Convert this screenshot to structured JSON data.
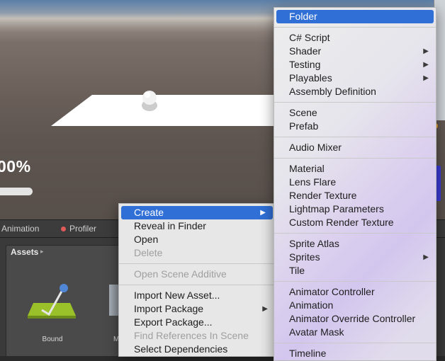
{
  "scene": {
    "progress_text": "00%",
    "progress_fraction": 0.88,
    "colors": {
      "plane": "#ffffff",
      "ball": "#e8e8e8",
      "bar": "#e4e4e4",
      "accent_blue": "#3d3bd9"
    }
  },
  "tabs": {
    "animation": "Animation",
    "profiler": "Profiler",
    "profiler_icon": "profiler-dot-icon"
  },
  "project": {
    "assets_title": "Assets",
    "asset_items": [
      {
        "label": "Bound",
        "icon": "mesh-asset-icon"
      },
      {
        "label": "M",
        "icon": "cube-asset-icon"
      }
    ]
  },
  "context_menu": {
    "items": [
      {
        "label": "Create",
        "submenu": true,
        "selected": true
      },
      {
        "label": "Reveal in Finder"
      },
      {
        "label": "Open"
      },
      {
        "label": "Delete",
        "disabled": true
      },
      {
        "label": "Open Scene Additive",
        "disabled": true
      },
      {
        "label": "Import New Asset..."
      },
      {
        "label": "Import Package",
        "submenu": true
      },
      {
        "label": "Export Package..."
      },
      {
        "label": "Find References In Scene",
        "disabled": true
      },
      {
        "label": "Select Dependencies"
      }
    ]
  },
  "create_submenu": {
    "items": [
      {
        "label": "Folder",
        "selected": true
      },
      {
        "label": "C# Script"
      },
      {
        "label": "Shader",
        "submenu": true
      },
      {
        "label": "Testing",
        "submenu": true
      },
      {
        "label": "Playables",
        "submenu": true
      },
      {
        "label": "Assembly Definition"
      },
      {
        "label": "Scene"
      },
      {
        "label": "Prefab"
      },
      {
        "label": "Audio Mixer"
      },
      {
        "label": "Material"
      },
      {
        "label": "Lens Flare"
      },
      {
        "label": "Render Texture"
      },
      {
        "label": "Lightmap Parameters"
      },
      {
        "label": "Custom Render Texture"
      },
      {
        "label": "Sprite Atlas"
      },
      {
        "label": "Sprites",
        "submenu": true
      },
      {
        "label": "Tile"
      },
      {
        "label": "Animator Controller"
      },
      {
        "label": "Animation"
      },
      {
        "label": "Animator Override Controller"
      },
      {
        "label": "Avatar Mask"
      },
      {
        "label": "Timeline"
      }
    ]
  },
  "submenu_arrow_glyph": "▶"
}
